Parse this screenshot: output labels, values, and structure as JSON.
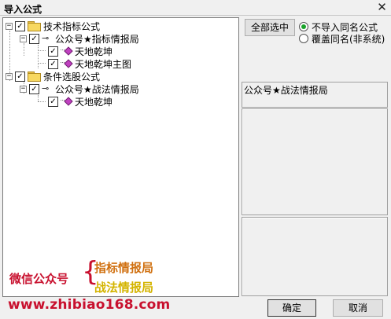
{
  "window": {
    "title": "导入公式",
    "close_symbol": "✕"
  },
  "tree": {
    "nodes": [
      {
        "expander": "−",
        "checked": true,
        "icon": "folder-icon",
        "label": "技术指标公式"
      },
      {
        "expander": "−",
        "checked": true,
        "icon": "key-icon",
        "label": "公众号★指标情报局"
      },
      {
        "expander": "",
        "checked": true,
        "icon": "gem-icon",
        "label": "天地乾坤"
      },
      {
        "expander": "",
        "checked": true,
        "icon": "gem-icon",
        "label": "天地乾坤主图"
      },
      {
        "expander": "−",
        "checked": true,
        "icon": "folder-icon",
        "label": "条件选股公式"
      },
      {
        "expander": "−",
        "checked": true,
        "icon": "key-icon",
        "label": "公众号★战法情报局"
      },
      {
        "expander": "",
        "checked": true,
        "icon": "gem-icon",
        "label": "天地乾坤"
      }
    ],
    "check_mark": "✓",
    "key_glyph": "⊸"
  },
  "watermark": {
    "label": "微信公众号",
    "brace": "{",
    "line1": "指标情报局",
    "line2": "战法情报局",
    "url": "www.zhibiao168.com"
  },
  "options": {
    "select_all_label": "全部选中",
    "radio_no_import": "不导入同名公式",
    "radio_overwrite": "覆盖同名(非系统)",
    "selected_radio": "no_import"
  },
  "info": {
    "name_text": "公众号★战法情报局",
    "description": "",
    "params": ""
  },
  "footer": {
    "ok_label": "确定",
    "cancel_label": "取消"
  },
  "colors": {
    "watermark_red": "#c8102e",
    "watermark_orange": "#d07010",
    "watermark_yellow": "#d4b400",
    "radio_green": "#1aa32a",
    "folder_yellow": "#f7d861",
    "gem_purple": "#c040c0"
  }
}
